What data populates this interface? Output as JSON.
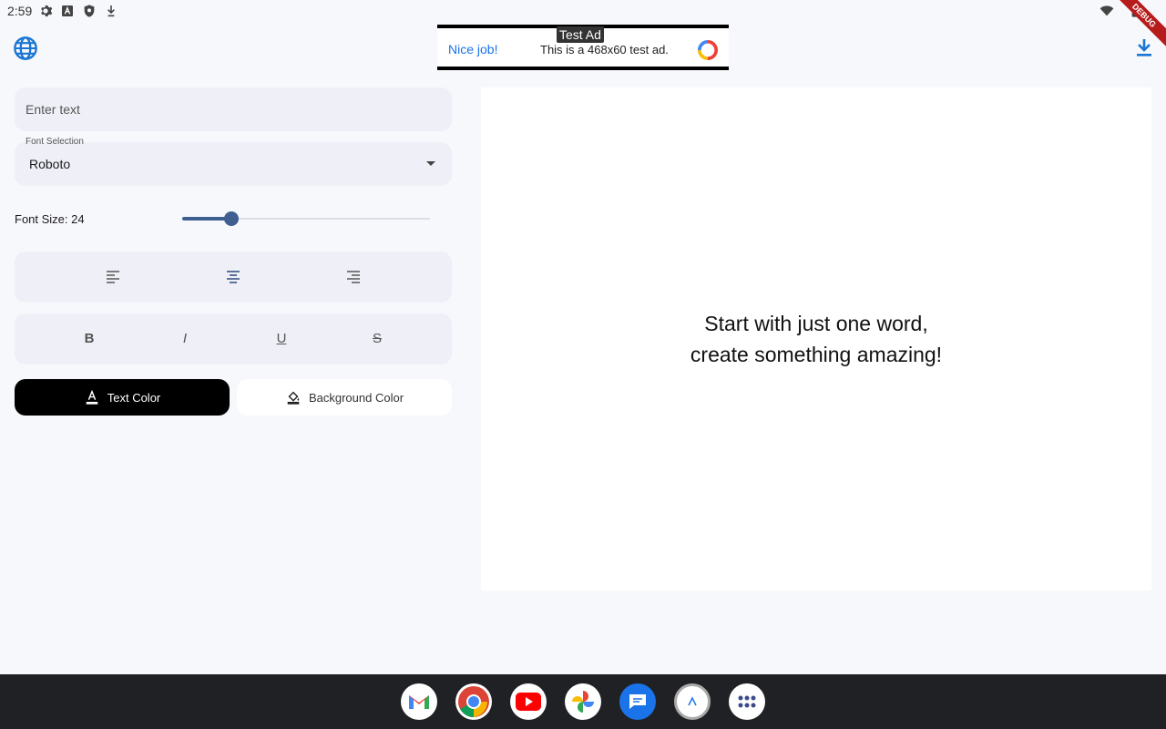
{
  "status_bar": {
    "time": "2:59",
    "icons": [
      "settings-icon",
      "font-icon",
      "shield-icon",
      "download-status-icon",
      "wifi-icon",
      "battery-icon"
    ],
    "debug_label": "DEBUG"
  },
  "app_bar": {
    "language_icon": "globe-icon",
    "download_icon": "download-icon"
  },
  "ad": {
    "tag": "Test Ad",
    "cta": "Nice job!",
    "text": "This is a 468x60 test ad."
  },
  "controls": {
    "text_input_placeholder": "Enter text",
    "font_selection_label": "Font Selection",
    "font_selection_value": "Roboto",
    "font_size_label": "Font Size: 24",
    "font_size_value": 24,
    "font_size_slider_fraction": 0.2,
    "alignment_buttons": [
      "align-left-icon",
      "align-center-icon",
      "align-right-icon"
    ],
    "style_buttons": [
      "B",
      "I",
      "U",
      "S"
    ],
    "text_color_label": "Text Color",
    "background_color_label": "Background Color"
  },
  "preview": {
    "line1": "Start with just one word,",
    "line2": "create something amazing!"
  },
  "colors": {
    "accent": "#3f5f90",
    "text_color_button_bg": "#000000",
    "panel_bg": "#eff0f7",
    "page_bg": "#f7f8fc",
    "link_blue": "#1a73e8"
  },
  "dock": {
    "apps": [
      "gmail-icon",
      "chrome-icon",
      "youtube-icon",
      "photos-icon",
      "messages-icon",
      "app-icon",
      "app-drawer-icon"
    ]
  }
}
